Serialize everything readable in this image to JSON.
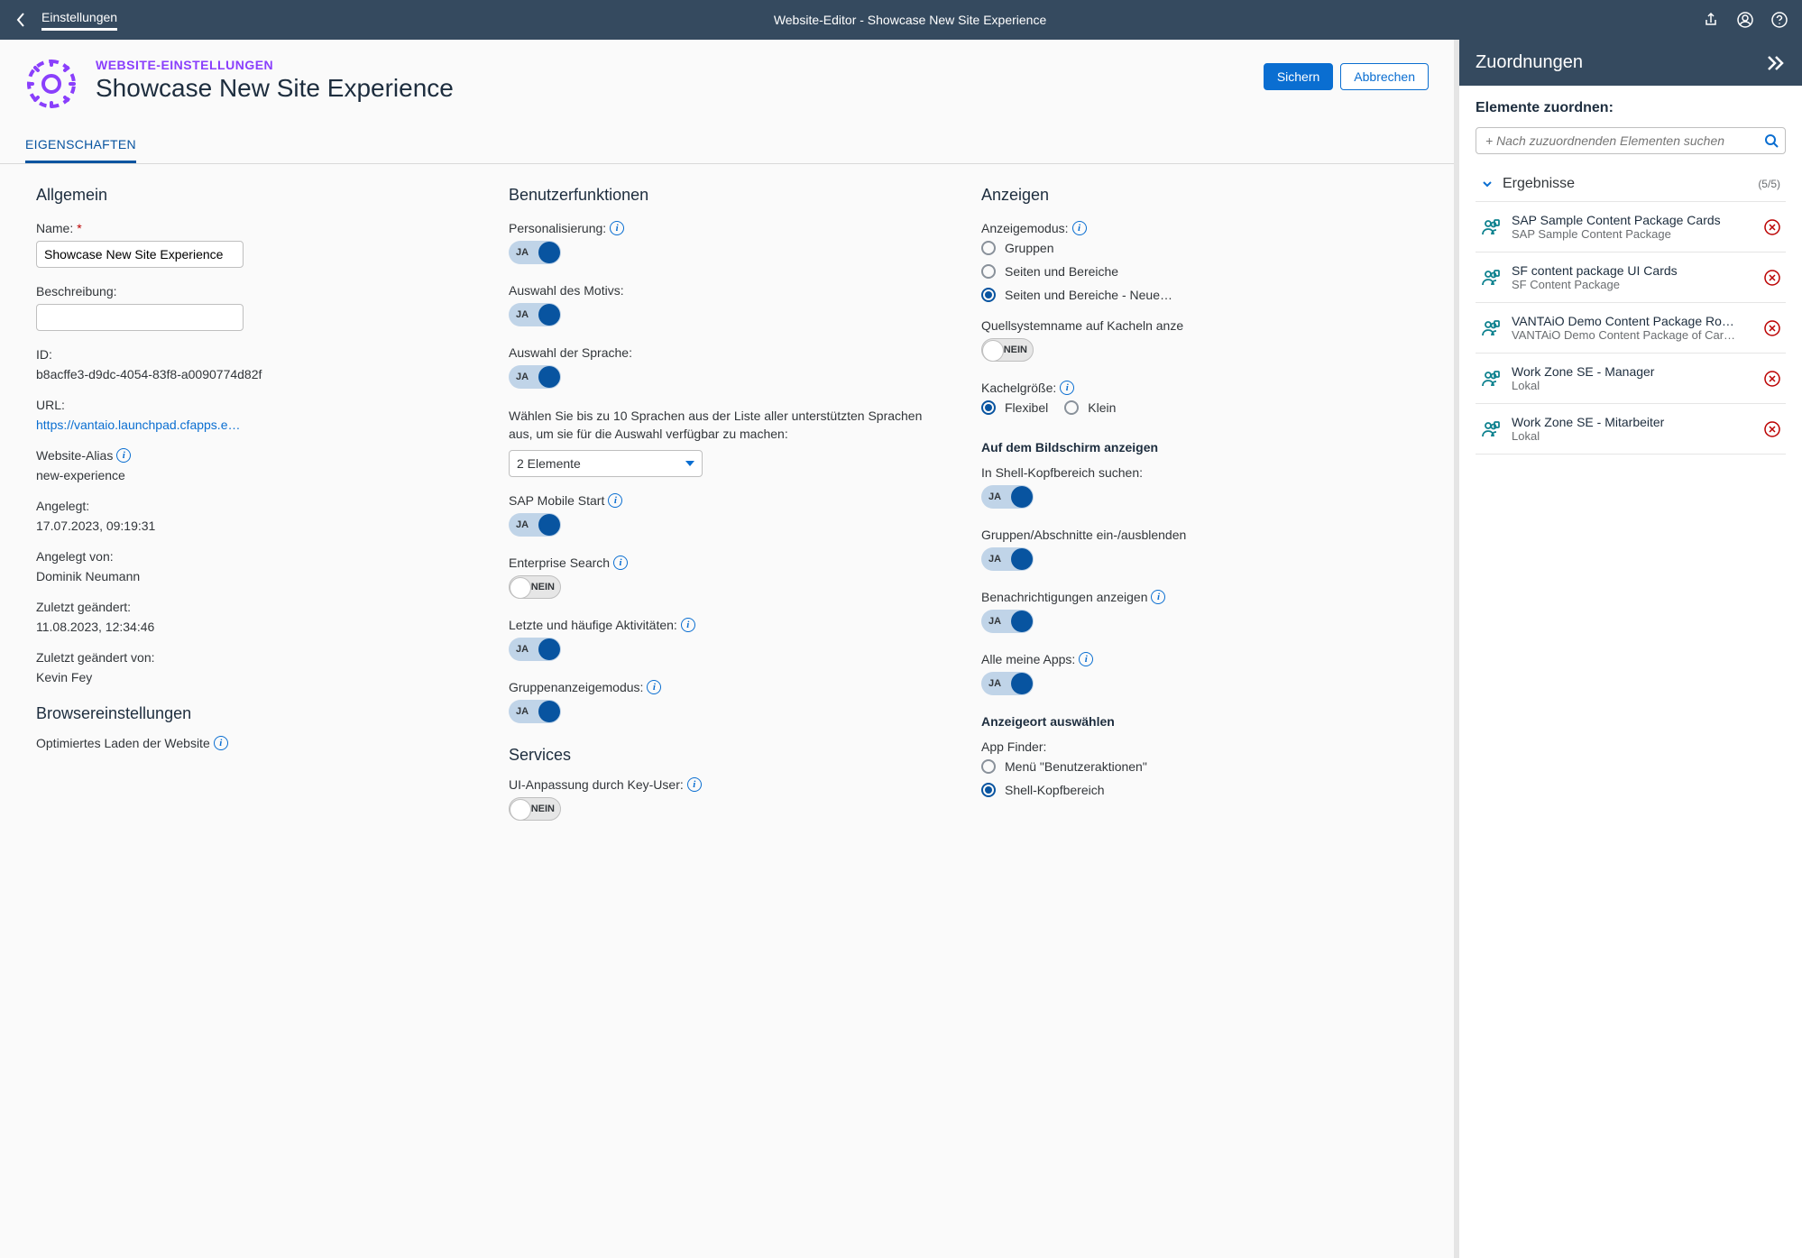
{
  "shell": {
    "nav": "Einstellungen",
    "title": "Website-Editor - Showcase New Site Experience"
  },
  "header": {
    "eyebrow": "WEBSITE-EINSTELLUNGEN",
    "title": "Showcase New Site Experience",
    "save": "Sichern",
    "cancel": "Abbrechen"
  },
  "tabs": {
    "active": "EIGENSCHAFTEN"
  },
  "general": {
    "heading": "Allgemein",
    "name_label": "Name:",
    "name_value": "Showcase New Site Experience",
    "desc_label": "Beschreibung:",
    "desc_value": "",
    "id_label": "ID:",
    "id_value": "b8acffe3-d9dc-4054-83f8-a0090774d82f",
    "url_label": "URL:",
    "url_value": "https://vantaio.launchpad.cfapps.e…",
    "alias_label": "Website-Alias",
    "alias_value": "new-experience",
    "created_label": "Angelegt:",
    "created_value": "17.07.2023, 09:19:31",
    "createdby_label": "Angelegt von:",
    "createdby_value": "Dominik Neumann",
    "changed_label": "Zuletzt geändert:",
    "changed_value": "11.08.2023, 12:34:46",
    "changedby_label": "Zuletzt geändert von:",
    "changedby_value": "Kevin Fey"
  },
  "browser": {
    "heading": "Browsereinstellungen",
    "opt_load": "Optimiertes Laden der Website"
  },
  "userfn": {
    "heading": "Benutzerfunktionen",
    "personalization": "Personalisierung:",
    "theme": "Auswahl des Motivs:",
    "language": "Auswahl der Sprache:",
    "lang_hint": "Wählen Sie bis zu 10 Sprachen aus der Liste aller unterstützten Sprachen aus, um sie für die Auswahl verfügbar zu machen:",
    "lang_select": "2 Elemente",
    "mobile_start": "SAP Mobile Start",
    "ent_search": "Enterprise Search",
    "recent": "Letzte und häufige Aktivitäten:",
    "group_mode": "Gruppenanzeigemodus:"
  },
  "services": {
    "heading": "Services",
    "keyuser": "UI-Anpassung durch Key-User:"
  },
  "toggle": {
    "on": "JA",
    "off": "NEIN"
  },
  "display": {
    "heading": "Anzeigen",
    "mode_label": "Anzeigemodus:",
    "mode_groups": "Gruppen",
    "mode_pages": "Seiten und Bereiche",
    "mode_pages_new": "Seiten und Bereiche - Neue…",
    "src_sys": "Quellsystemname auf Kacheln anze",
    "tile_size": "Kachelgröße:",
    "size_flex": "Flexibel",
    "size_small": "Klein",
    "on_screen": "Auf dem Bildschirm anzeigen",
    "search_shell": "In Shell-Kopfbereich suchen:",
    "groups_toggle": "Gruppen/Abschnitte ein-/ausblenden",
    "notifications": "Benachrichtigungen anzeigen",
    "all_apps": "Alle meine Apps:",
    "display_loc": "Anzeigeort auswählen",
    "app_finder": "App Finder:",
    "af_menu": "Menü \"Benutzeraktionen\"",
    "af_shell": "Shell-Kopfbereich"
  },
  "side": {
    "title": "Zuordnungen",
    "subtitle": "Elemente zuordnen:",
    "search_placeholder": "+ Nach zuzuordnenden Elementen suchen",
    "results_label": "Ergebnisse",
    "count": "(5/5)",
    "items": [
      {
        "title": "SAP Sample Content Package Cards",
        "sub": "SAP Sample Content Package"
      },
      {
        "title": "SF content package UI Cards",
        "sub": "SF Content Package"
      },
      {
        "title": "VANTAiO Demo Content Package Ro…",
        "sub": "VANTAiO Demo Content Package of Car…"
      },
      {
        "title": "Work Zone SE - Manager",
        "sub": "Lokal"
      },
      {
        "title": "Work Zone SE - Mitarbeiter",
        "sub": "Lokal"
      }
    ]
  }
}
